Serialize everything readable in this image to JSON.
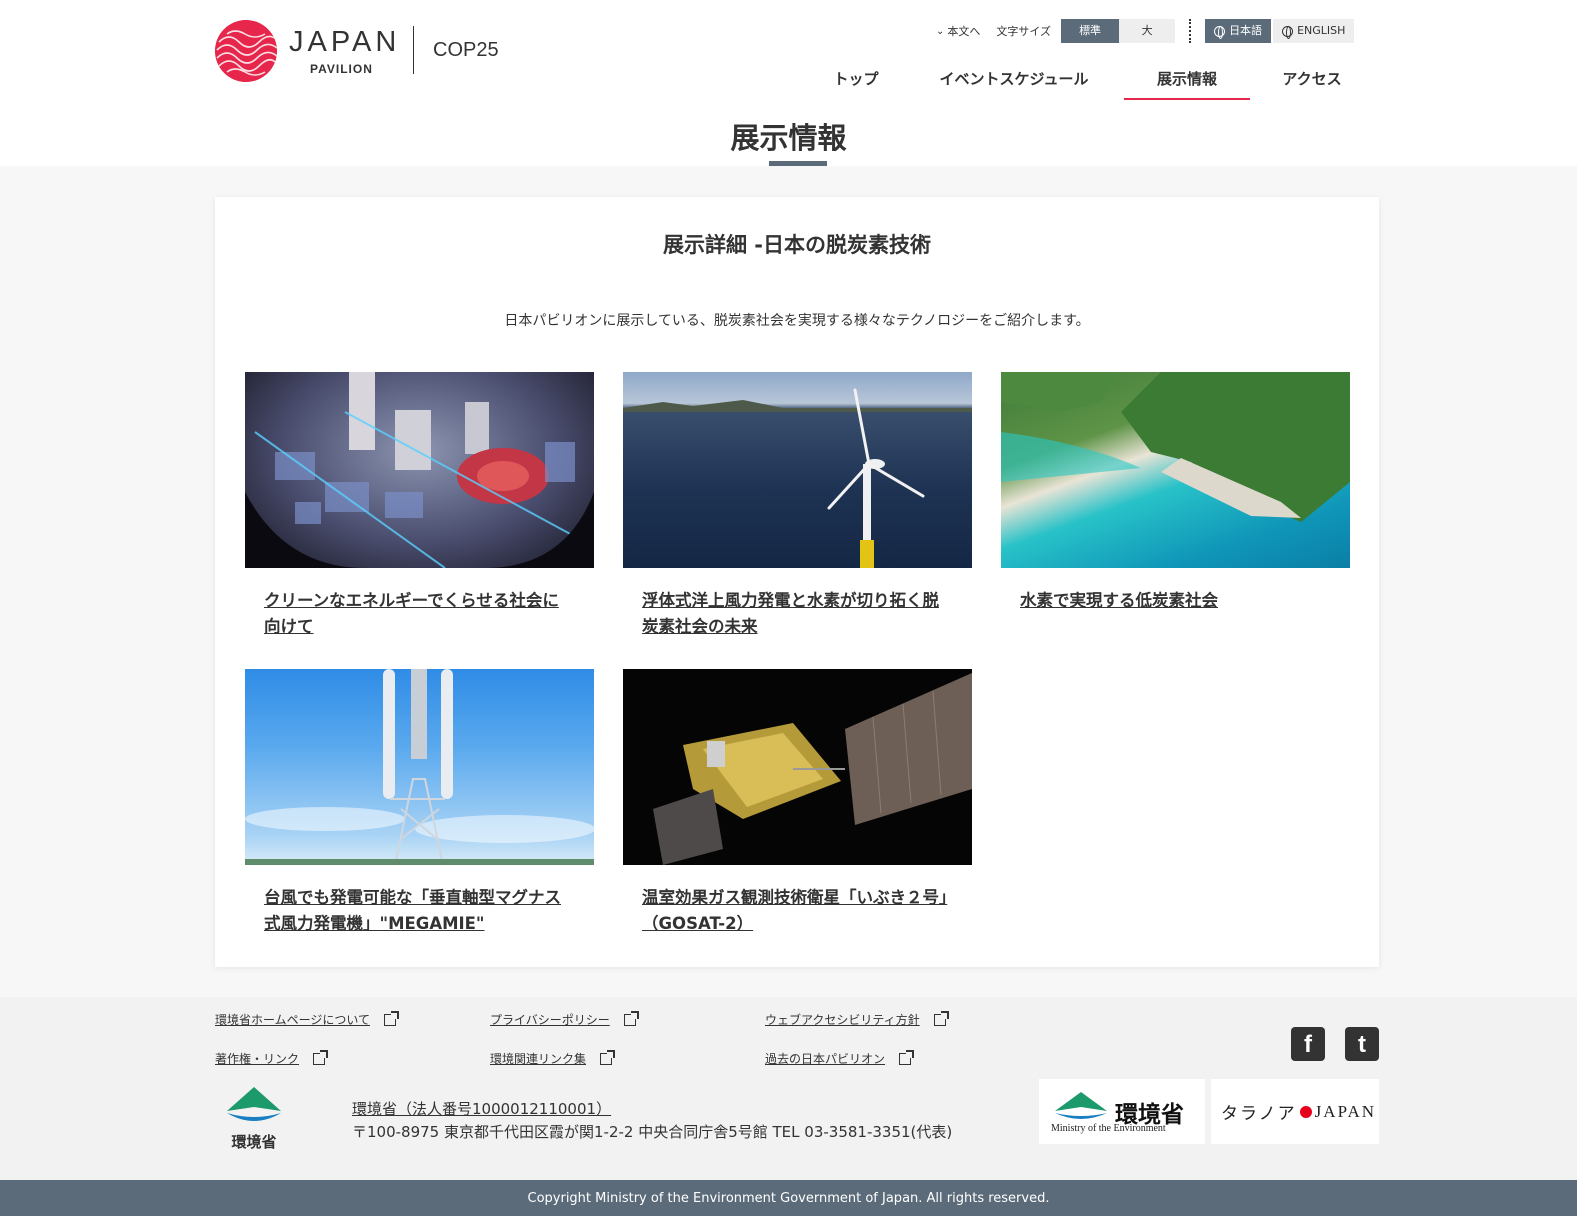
{
  "header": {
    "logo_main": "JAPAN",
    "logo_sub": "PAVILION",
    "event": "COP25",
    "skip_label": "本文へ",
    "font_size_label": "文字サイズ",
    "font_size_standard": "標準",
    "font_size_large": "大",
    "lang_ja": "日本語",
    "lang_en": "ENGLISH"
  },
  "nav": [
    {
      "label": "トップ"
    },
    {
      "label": "イベントスケジュール"
    },
    {
      "label": "展示情報",
      "active": true
    },
    {
      "label": "アクセス"
    }
  ],
  "page": {
    "title": "展示情報"
  },
  "content": {
    "heading": "展示詳細 -日本の脱炭素技術",
    "description": "日本パビリオンに展示している、脱炭素社会を実現する様々なテクノロジーをご紹介します。",
    "items": [
      {
        "title": "クリーンなエネルギーでくらせる社会に向けて",
        "image": "city-model-image"
      },
      {
        "title": "浮体式洋上風力発電と水素が切り拓く脱炭素社会の未来",
        "image": "offshore-wind-turbine-image"
      },
      {
        "title": "水素で実現する低炭素社会",
        "image": "island-coast-image"
      },
      {
        "title": "台風でも発電可能な「垂直軸型マグナス式風力発電機」\"MEGAMIE\"",
        "image": "vertical-wind-turbine-image"
      },
      {
        "title": "温室効果ガス観測技術衛星「いぶき２号」（GOSAT-2）",
        "image": "satellite-image"
      }
    ]
  },
  "footer": {
    "links": [
      "環境省ホームページについて",
      "プライバシーポリシー",
      "ウェブアクセシビリティ方針",
      "著作権・リンク",
      "環境関連リンク集",
      "過去の日本パビリオン"
    ],
    "social": {
      "facebook": "f",
      "twitter": "t"
    },
    "moe_logo_text": "環境省",
    "org_name": "環境省（法人番号1000012110001）",
    "org_address": "〒100-8975 東京都千代田区霞が関1-2-2 中央合同庁舎5号館 TEL 03-3581-3351(代表)",
    "banner_moe_ja": "環境省",
    "banner_moe_en": "Ministry of the Environment",
    "banner_tara_left": "タラノア",
    "banner_tara_right": "JAPAN",
    "copyright": "Copyright Ministry of the Environment Government of Japan. All rights reserved."
  },
  "colors": {
    "brand_red": "#e6274b",
    "slate": "#5b6b7a",
    "background": "#f7f7f7"
  }
}
